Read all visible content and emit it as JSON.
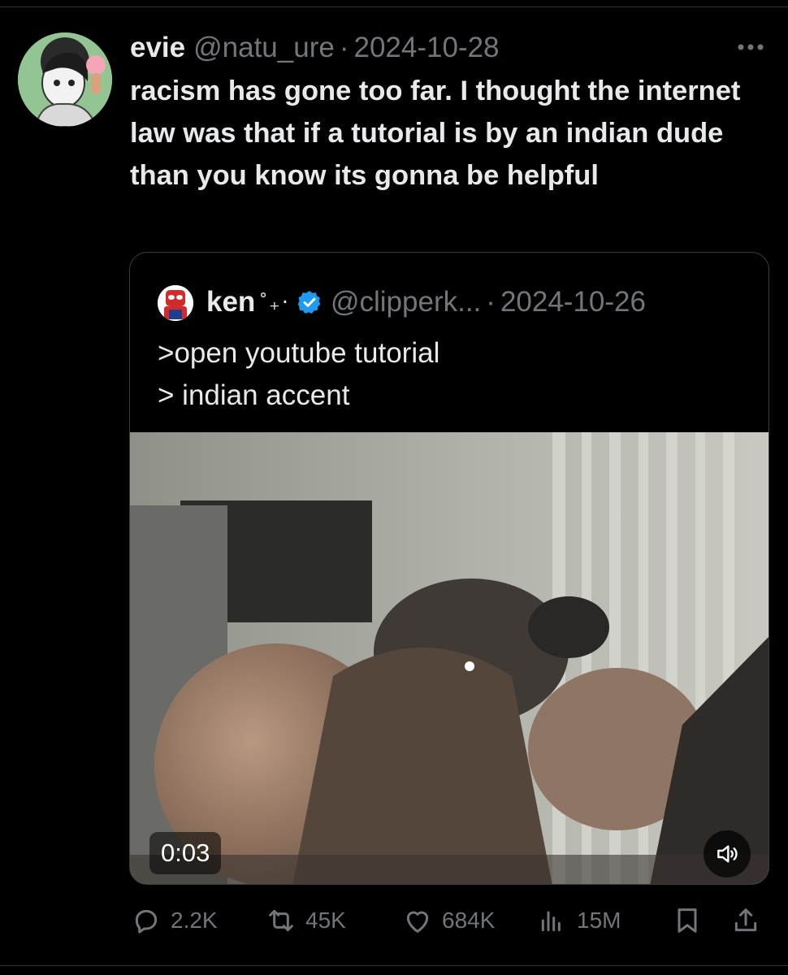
{
  "tweet": {
    "author_name": "evie",
    "handle": "@natu_ure",
    "separator": "·",
    "date": "2024-10-28",
    "text": "racism has gone too far. I thought the internet law was that if a tutorial is by an indian dude than you know its gonna be helpful",
    "more_icon": "ellipsis-icon"
  },
  "quoted": {
    "author_name": "ken",
    "decoration": "˚₊‧",
    "verified_icon": "verified-badge-icon",
    "handle": "@clipperk...",
    "separator": "·",
    "date": "2024-10-26",
    "lines": [
      ">open youtube tutorial",
      "> indian accent"
    ],
    "video": {
      "duration": "0:03",
      "volume_icon": "speaker-icon"
    }
  },
  "actions": {
    "replies": "2.2K",
    "reposts": "45K",
    "likes": "684K",
    "views": "15M",
    "icons": [
      "reply-icon",
      "repost-icon",
      "like-icon",
      "views-icon",
      "bookmark-icon",
      "share-icon"
    ]
  },
  "colors": {
    "background": "#000000",
    "text": "#e7e9ea",
    "muted": "#71767b",
    "verified": "#1d9bf0",
    "border": "#3a3d40"
  }
}
